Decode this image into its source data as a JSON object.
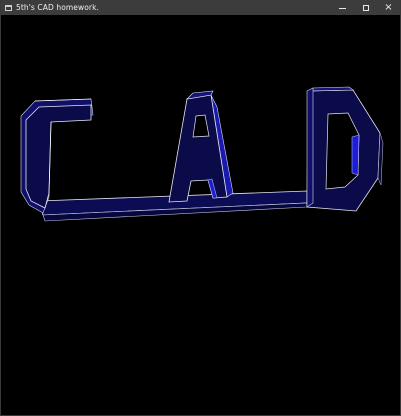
{
  "window": {
    "title": "5th's CAD homework.",
    "controls": {
      "minimize": "minimize",
      "maximize": "maximize",
      "close": "×"
    }
  },
  "scene": {
    "text": "CAD",
    "colors": {
      "background": "#000000",
      "face": "#0b0b4a",
      "side": "#14147a",
      "bright_side": "#1d1dd8",
      "edge": "#e6e6f2"
    }
  }
}
